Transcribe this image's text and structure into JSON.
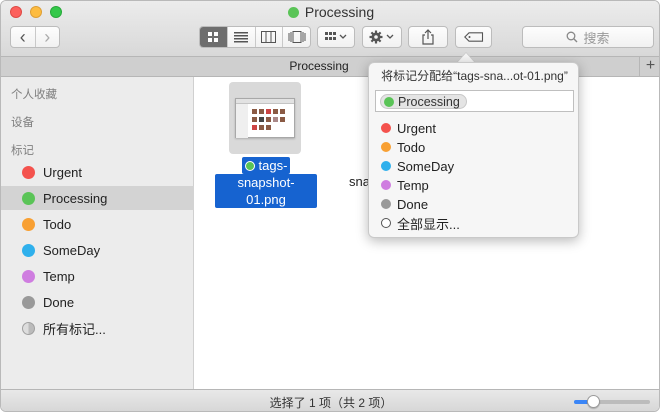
{
  "window": {
    "title": "Processing",
    "title_tag_color": "#5ac457"
  },
  "toolbar": {
    "back_glyph": "‹",
    "forward_glyph": "›",
    "view_icons": [
      "icon-view-icon",
      "list-view-icon",
      "column-view-icon",
      "coverflow-view-icon"
    ],
    "arrange_icon": "arrange-grid-icon",
    "action_icon": "gear-icon",
    "share_icon": "share-icon",
    "tags_icon": "tag-icon",
    "search_placeholder": "搜索"
  },
  "tabbar": {
    "title": "Processing",
    "add_tab": "+"
  },
  "sidebar": {
    "headings": [
      "个人收藏",
      "设备",
      "标记"
    ],
    "tags": [
      {
        "label": "Urgent",
        "color": "#f4524d"
      },
      {
        "label": "Processing",
        "color": "#5ac457"
      },
      {
        "label": "Todo",
        "color": "#f8a033"
      },
      {
        "label": "SomeDay",
        "color": "#2fb0ec"
      },
      {
        "label": "Temp",
        "color": "#cf7de0"
      },
      {
        "label": "Done",
        "color": "#999999"
      }
    ],
    "all_tags": "所有标记...",
    "selected": "Processing"
  },
  "content": {
    "file1": {
      "line1": "tags-",
      "line2": "snapshot-01.png",
      "tag_color": "#5ac457"
    },
    "file2_partial": "sna"
  },
  "popover": {
    "title": "将标记分配给“tags-sna...ot-01.png”",
    "token": "Processing",
    "token_color": "#5ac457",
    "items": [
      {
        "label": "Urgent",
        "color": "#f4524d"
      },
      {
        "label": "Todo",
        "color": "#f8a033"
      },
      {
        "label": "SomeDay",
        "color": "#2fb0ec"
      },
      {
        "label": "Temp",
        "color": "#cf7de0"
      },
      {
        "label": "Done",
        "color": "#999999"
      }
    ],
    "show_all": "全部显示..."
  },
  "statusbar": {
    "text": "选择了 1 项（共 2 项）",
    "icon_size_slider": 0.25
  }
}
